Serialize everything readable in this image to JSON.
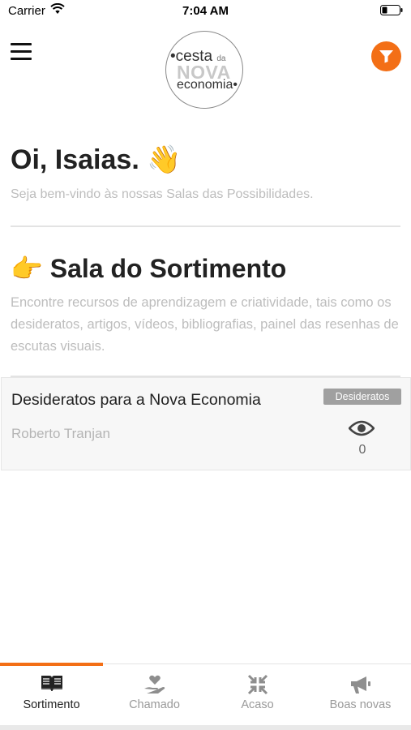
{
  "status_bar": {
    "carrier": "Carrier",
    "time": "7:04 AM"
  },
  "header": {
    "logo": {
      "line1": "cesta",
      "line1_small": "da",
      "line2": "NOVA",
      "line3": "economia"
    },
    "accent_color": "#f36f16"
  },
  "greeting": {
    "title": "Oi, Isaias. 👋",
    "subtitle": "Seja bem-vindo às nossas Salas das Possibilidades."
  },
  "section": {
    "title": "👉 Sala do Sortimento",
    "description": "Encontre recursos de aprendizagem e criatividade, tais como os desideratos, artigos, vídeos, bibliografias, painel das resenhas de escutas visuais."
  },
  "cards": [
    {
      "title": "Desideratos para a Nova Economia",
      "badge": "Desideratos",
      "author": "Roberto Tranjan",
      "views": "0"
    }
  ],
  "tabs": [
    {
      "label": "Sortimento",
      "icon": "book-icon",
      "active": true
    },
    {
      "label": "Chamado",
      "icon": "hand-heart-icon",
      "active": false
    },
    {
      "label": "Acaso",
      "icon": "arrows-converge-icon",
      "active": false
    },
    {
      "label": "Boas novas",
      "icon": "megaphone-icon",
      "active": false
    }
  ]
}
